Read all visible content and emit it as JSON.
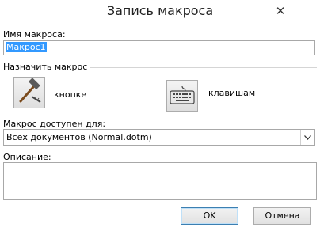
{
  "dialog": {
    "title": "Запись макроса",
    "close_glyph": "✕"
  },
  "name_field": {
    "label": "Имя макроса:",
    "value": "Макрос1"
  },
  "assign": {
    "label": "Назначить макрос",
    "button_label": "кнопке",
    "keyboard_label": "клавишам"
  },
  "store": {
    "label": "Макрос доступен для:",
    "value": "Всех документов (Normal.dotm)"
  },
  "description": {
    "label": "Описание:",
    "value": ""
  },
  "actions": {
    "ok": "OK",
    "cancel": "Отмена"
  }
}
